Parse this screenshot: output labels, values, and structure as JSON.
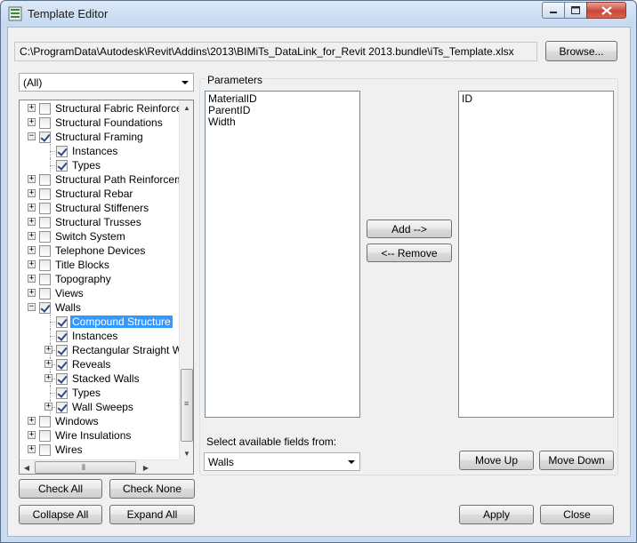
{
  "window": {
    "title": "Template Editor"
  },
  "header": {
    "path": "C:\\ProgramData\\Autodesk\\Revit\\Addins\\2013\\BIMiTs_DataLink_for_Revit 2013.bundle\\iTs_Template.xlsx",
    "browse_label": "Browse..."
  },
  "filter": {
    "selected": "(All)"
  },
  "tree": {
    "rows": [
      {
        "label": "Structural Fabric Reinforcement",
        "level": 0,
        "expander": "+",
        "checked": false
      },
      {
        "label": "Structural Foundations",
        "level": 0,
        "expander": "+",
        "checked": false
      },
      {
        "label": "Structural Framing",
        "level": 0,
        "expander": "-",
        "checked": true
      },
      {
        "label": "Instances",
        "level": 1,
        "expander": "",
        "checked": true
      },
      {
        "label": "Types",
        "level": 1,
        "expander": "",
        "checked": true
      },
      {
        "label": "Structural Path Reinforcement",
        "level": 0,
        "expander": "+",
        "checked": false
      },
      {
        "label": "Structural Rebar",
        "level": 0,
        "expander": "+",
        "checked": false
      },
      {
        "label": "Structural Stiffeners",
        "level": 0,
        "expander": "+",
        "checked": false
      },
      {
        "label": "Structural Trusses",
        "level": 0,
        "expander": "+",
        "checked": false
      },
      {
        "label": "Switch System",
        "level": 0,
        "expander": "+",
        "checked": false
      },
      {
        "label": "Telephone Devices",
        "level": 0,
        "expander": "+",
        "checked": false
      },
      {
        "label": "Title Blocks",
        "level": 0,
        "expander": "+",
        "checked": false
      },
      {
        "label": "Topography",
        "level": 0,
        "expander": "+",
        "checked": false
      },
      {
        "label": "Views",
        "level": 0,
        "expander": "+",
        "checked": false
      },
      {
        "label": "Walls",
        "level": 0,
        "expander": "-",
        "checked": true
      },
      {
        "label": "Compound Structure",
        "level": 1,
        "expander": "",
        "checked": true,
        "selected": true
      },
      {
        "label": "Instances",
        "level": 1,
        "expander": "",
        "checked": true
      },
      {
        "label": "Rectangular Straight Wall Opening",
        "level": 1,
        "expander": "+",
        "checked": true
      },
      {
        "label": "Reveals",
        "level": 1,
        "expander": "+",
        "checked": true
      },
      {
        "label": "Stacked Walls",
        "level": 1,
        "expander": "+",
        "checked": true
      },
      {
        "label": "Types",
        "level": 1,
        "expander": "",
        "checked": true
      },
      {
        "label": "Wall Sweeps",
        "level": 1,
        "expander": "+",
        "checked": true
      },
      {
        "label": "Windows",
        "level": 0,
        "expander": "+",
        "checked": false
      },
      {
        "label": "Wire Insulations",
        "level": 0,
        "expander": "+",
        "checked": false
      },
      {
        "label": "Wires",
        "level": 0,
        "expander": "+",
        "checked": false
      }
    ]
  },
  "left_buttons": {
    "check_all": "Check All",
    "check_none": "Check None",
    "collapse_all": "Collapse All",
    "expand_all": "Expand All"
  },
  "parameters": {
    "group_label": "Parameters",
    "available": [
      "MaterialID",
      "ParentID",
      "Width"
    ],
    "selected": [
      "ID"
    ],
    "add_label": "Add -->",
    "remove_label": "<-- Remove",
    "source_label": "Select available fields from:",
    "source_value": "Walls",
    "move_up_label": "Move Up",
    "move_down_label": "Move Down"
  },
  "footer": {
    "apply_label": "Apply",
    "close_label": "Close"
  }
}
